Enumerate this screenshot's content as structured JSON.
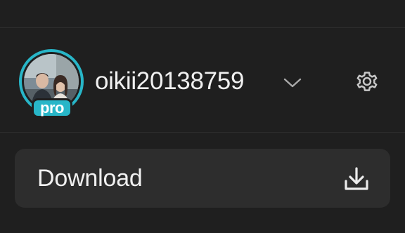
{
  "profile": {
    "username": "oikii20138759",
    "badge": "pro",
    "avatar": "user-avatar-photo",
    "accent_color": "#28b6c8"
  },
  "icons": {
    "dropdown": "chevron-down-icon",
    "settings": "gear-icon",
    "download": "download-icon"
  },
  "actions": {
    "download_label": "Download"
  },
  "theme": {
    "background": "#1f1f1f",
    "button_bg": "#2d2d2d",
    "text": "#f0f0f0",
    "icon": "#c8c8c8"
  }
}
